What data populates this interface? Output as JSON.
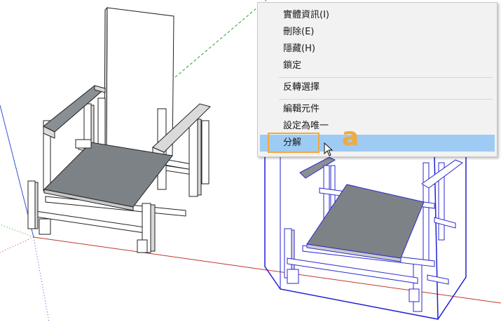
{
  "context_menu": {
    "items": [
      {
        "label": "實體資訊(I)"
      },
      {
        "label": "刪除(E)"
      },
      {
        "label": "隱藏(H)"
      },
      {
        "label": "鎖定"
      },
      {
        "label": "反轉選擇"
      },
      {
        "label": "編輯元件"
      },
      {
        "label": "設定為唯一"
      },
      {
        "label": "分解",
        "selected": true
      }
    ]
  },
  "annotation": {
    "callout_letter": "a"
  },
  "colors": {
    "accent_orange": "#f2a93b",
    "selection_blue": "#1f1fd6",
    "menu_highlight": "#9ecbf4",
    "axis_red": "#c0392b",
    "axis_green": "#2ca02c",
    "seat_gray": "#7d8286"
  },
  "icons": {
    "cursor": "arrow-pointer-icon"
  }
}
